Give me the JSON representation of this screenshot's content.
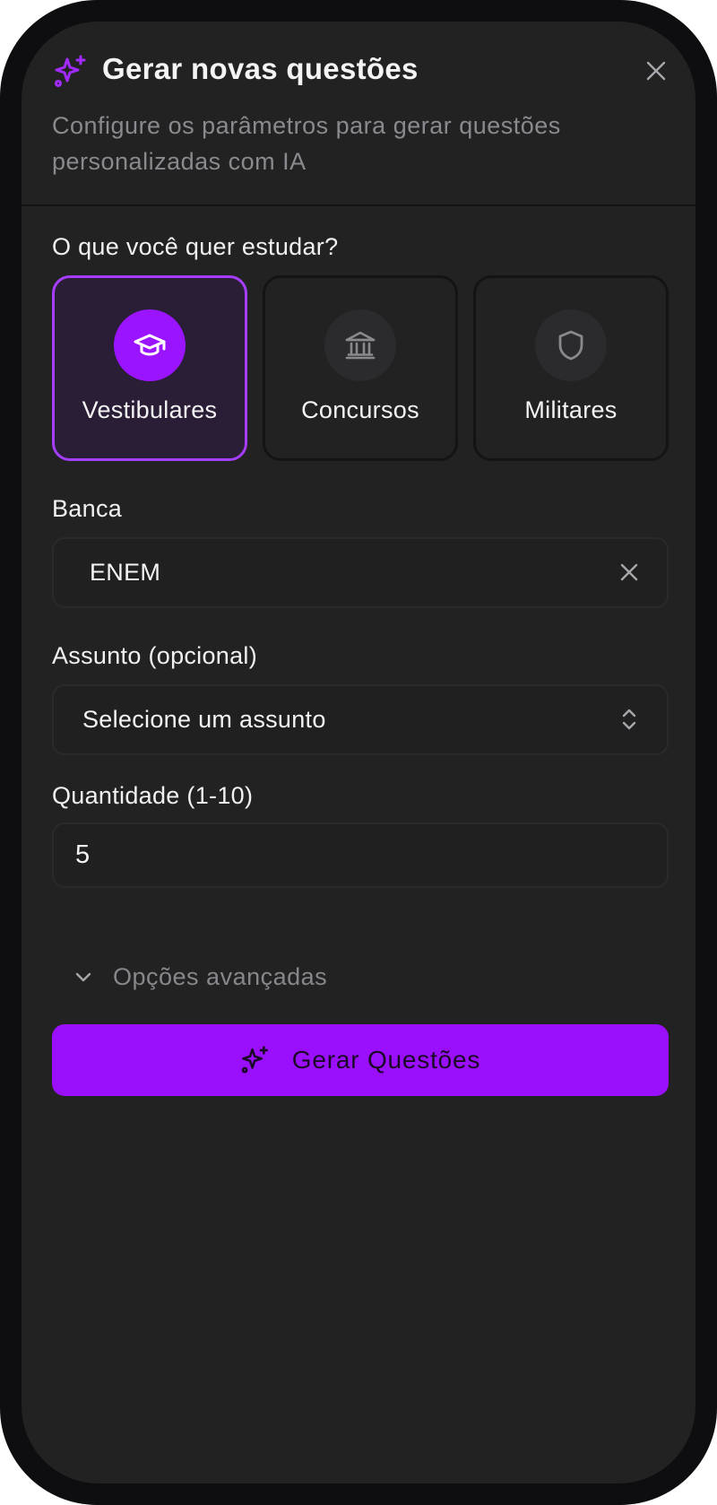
{
  "header": {
    "title": "Gerar novas questões",
    "subtitle": "Configure os parâmetros para gerar questões personalizadas com IA",
    "icon": "sparkles-icon",
    "close_icon": "close-icon"
  },
  "study": {
    "label": "O que você quer estudar?",
    "options": [
      {
        "label": "Vestibulares",
        "icon": "graduation-cap-icon",
        "selected": true
      },
      {
        "label": "Concursos",
        "icon": "landmark-icon",
        "selected": false
      },
      {
        "label": "Militares",
        "icon": "shield-icon",
        "selected": false
      }
    ]
  },
  "banca": {
    "label": "Banca",
    "value": "ENEM",
    "clear_icon": "close-icon"
  },
  "assunto": {
    "label": "Assunto (opcional)",
    "placeholder": "Selecione um assunto",
    "icon": "chevrons-up-down-icon"
  },
  "quantidade": {
    "label": "Quantidade (1-10)",
    "value": "5"
  },
  "advanced": {
    "label": "Opções avançadas",
    "icon": "chevron-down-icon"
  },
  "generate": {
    "label": "Gerar Questões",
    "icon": "sparkles-icon"
  },
  "colors": {
    "accent": "#9a0ffc",
    "selected_border": "#a63eff",
    "background": "#222223",
    "frame": "#0e0e10"
  }
}
